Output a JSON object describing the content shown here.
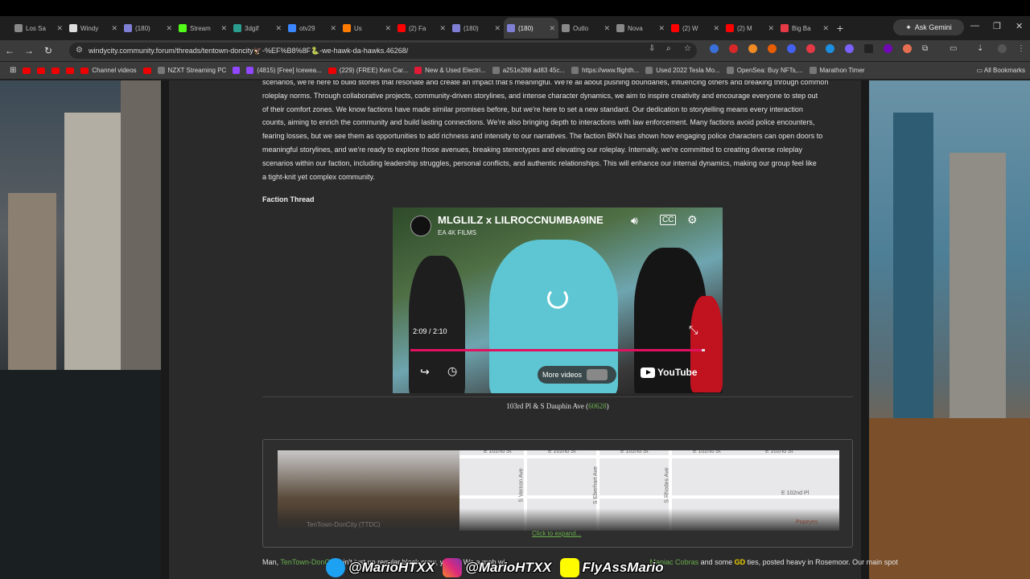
{
  "browser": {
    "tabs": [
      {
        "label": "Los Sa",
        "color": "#888888"
      },
      {
        "label": "Windy",
        "color": "#dddddd"
      },
      {
        "label": "(180)",
        "color": "#7f7fd6"
      },
      {
        "label": "Stream",
        "color": "#53fc18"
      },
      {
        "label": "3dgif",
        "color": "#2a9d8f"
      },
      {
        "label": "otv29",
        "color": "#3a86ff"
      },
      {
        "label": "Us",
        "color": "#ff7a00"
      },
      {
        "label": "(2) Fa",
        "color": "#ff0000"
      },
      {
        "label": "(180)",
        "color": "#7f7fd6"
      },
      {
        "label": "(180)",
        "color": "#7f7fd6",
        "active": true
      },
      {
        "label": "Outlo",
        "color": "#888888"
      },
      {
        "label": "Nova",
        "color": "#888888"
      },
      {
        "label": "(2) W",
        "color": "#ff0000"
      },
      {
        "label": "(2) M",
        "color": "#ff0000"
      },
      {
        "label": "Big Ba",
        "color": "#e63946"
      }
    ],
    "new_tab": "+",
    "gemini_label": "Ask Gemini",
    "url": "windycity.community.forum/threads/tentown-doncity🦅-%EF%B8%8F🐍-we-hawk-da-hawks.46268/",
    "bookmarks": [
      {
        "label": "",
        "type": "yt"
      },
      {
        "label": "",
        "type": "yt"
      },
      {
        "label": "",
        "type": "yt"
      },
      {
        "label": "",
        "type": "yt"
      },
      {
        "label": "Channel videos",
        "type": "yt"
      },
      {
        "label": "",
        "type": "yt"
      },
      {
        "label": "NZXT Streaming PC",
        "type": "other"
      },
      {
        "label": "",
        "type": "twitch"
      },
      {
        "label": "(4815) [Free] Icewea...",
        "type": "twitch"
      },
      {
        "label": "(229) (FREE) Ken Car...",
        "type": "yt"
      },
      {
        "label": "New & Used Electri...",
        "type": "tesla"
      },
      {
        "label": "a251e288 ad83 45c...",
        "type": "other"
      },
      {
        "label": "https://www.flighth...",
        "type": "other"
      },
      {
        "label": "Used 2022 Tesla Mo...",
        "type": "other"
      },
      {
        "label": "OpenSea: Buy NFTs,...",
        "type": "other"
      },
      {
        "label": "Marathon Timer",
        "type": "other"
      }
    ],
    "all_bookmarks": "All Bookmarks"
  },
  "post": {
    "paragraph_lines": [
      "scenarios, we're here to build stories that resonate and create an impact that's meaningful. We're all about pushing boundaries, influencing others and breaking through common",
      "roleplay norms. Through collaborative projects, community-driven storylines, and intense character dynamics, we aim to inspire creativity and encourage everyone to step out",
      "of their comfort zones. We know factions have made similar promises before, but we're here to set a new standard. Our dedication to storytelling means every interaction",
      "counts, aiming to enrich the community and build lasting connections. We're also bringing depth to interactions with law enforcement. Many factions avoid police encounters,",
      "fearing losses, but we see them as opportunities to add richness and intensity to our narratives. The faction BKN has shown how engaging police characters can open doors to",
      "meaningful storylines, and we're ready to explore those avenues, breaking stereotypes and elevating our roleplay. Internally, we're committed to creating diverse roleplay",
      "scenarios within our faction, including leadership struggles, personal conflicts, and authentic relationships. This will enhance our internal dynamics, making our group feel like",
      "a tight-knit yet complex community."
    ],
    "faction_thread_heading": "Faction Thread",
    "address_text": "103rd Pl & S Dauphin Ave (",
    "address_zip": "60628",
    "address_close": ")",
    "click_to_expand": "Click to expand...",
    "embed_ghost_text": "TenTown-DonCity (TTDC)",
    "bottom_prefix": "Man, ",
    "bottom_link": "TenTown-DonCity",
    "bottom_mid1": " ain't just no regular block crew, ya dig. We a mob wi",
    "bottom_highlight": "Maniac Cobras",
    "bottom_mid2": " and some ",
    "bottom_gd": "GD",
    "bottom_tail": " ties, posted heavy in Rosemoor. Our main spot"
  },
  "video": {
    "title": "MLGLILZ x LILROCCNUMBA9INE",
    "channel": "EA 4K FILMS",
    "time": "2:09 / 2:10",
    "progress_fraction": 0.99,
    "more_videos": "More videos",
    "youtube_label": "YouTube"
  },
  "map": {
    "streets_h": [
      "E 102nd St",
      "E 102nd St",
      "E 102nd St",
      "E 102nd St",
      "E 102nd St",
      "E 102nd Pl"
    ],
    "streets_v": [
      "S Vernon Ave",
      "S Eberhart Ave",
      "S Rhodes Ave"
    ],
    "poi": "Popeyes"
  },
  "overlay": {
    "twitter": "@MarioHTXX",
    "instagram": "@MarioHTXX",
    "snapchat": "FlyAssMario"
  }
}
